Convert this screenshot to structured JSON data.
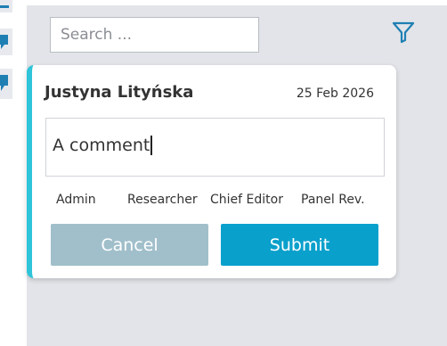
{
  "search": {
    "placeholder": "Search ..."
  },
  "icons": {
    "filter": "filter-icon",
    "comment": "comment-icon"
  },
  "comment_card": {
    "author": "Justyna Lityńska",
    "date": "25 Feb 2026",
    "text": "A comment",
    "roles": [
      "Admin",
      "Researcher",
      "Chief Editor",
      "Panel Rev."
    ],
    "cancel_label": "Cancel",
    "submit_label": "Submit"
  },
  "colors": {
    "accent": "#2ec4d9",
    "submit": "#0aa0cc",
    "cancel": "#a0bfcb",
    "icon": "#1f7fb3",
    "panel_bg": "#e2e4e9"
  }
}
